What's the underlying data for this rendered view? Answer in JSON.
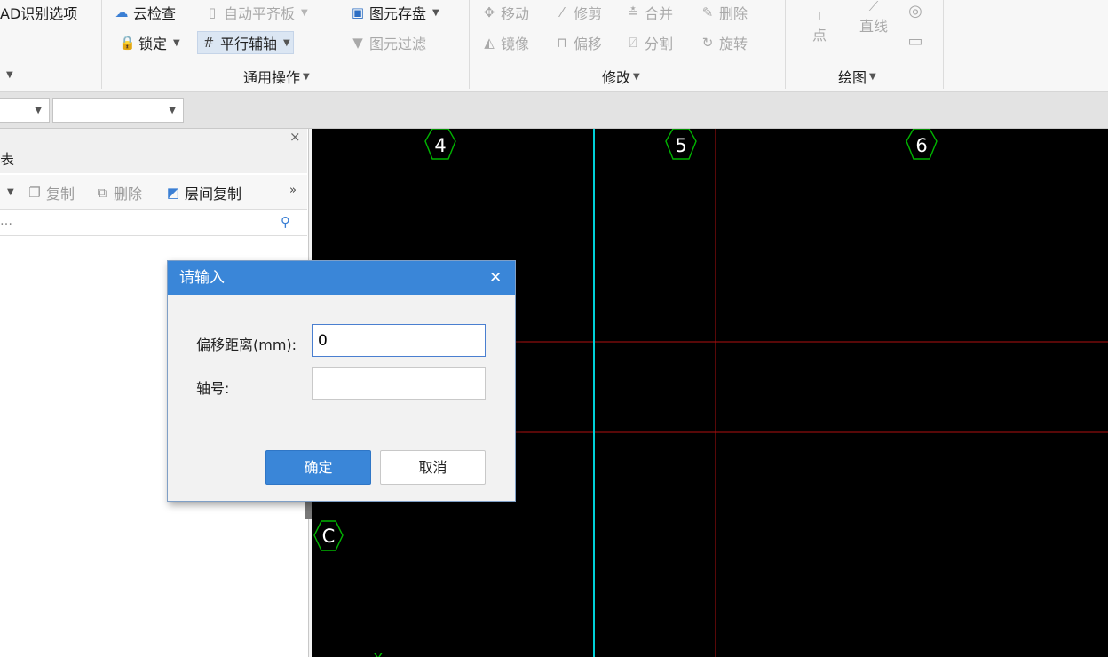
{
  "ribbon": {
    "cad_options": "AD识别选项",
    "general_ops": {
      "cloud_check": "云检查",
      "auto_align": "自动平齐板",
      "element_save": "图元存盘",
      "lock": "锁定",
      "parallel_axis": "平行辅轴",
      "element_filter": "图元过滤",
      "group_label": "通用操作"
    },
    "modify": {
      "move": "移动",
      "trim": "修剪",
      "merge": "合并",
      "delete": "删除",
      "mirror": "镜像",
      "offset": "偏移",
      "split": "分割",
      "rotate": "旋转",
      "group_label": "修改"
    },
    "draw": {
      "point": "点",
      "line": "直线",
      "group_label": "绘图"
    }
  },
  "left_panel": {
    "close_glyph": "×",
    "title_fragment": "表",
    "tools": {
      "copy": "复制",
      "delete": "删除",
      "floor_copy": "层间复制",
      "more": "»"
    },
    "search_placeholder": "…"
  },
  "canvas": {
    "axis_labels": [
      "4",
      "5",
      "6"
    ],
    "row_label": "C",
    "y_axis_marker": "Y",
    "colors": {
      "background": "#000000",
      "axis_line": "#00d0d8",
      "grid_line": "#b01010",
      "marker": "#00b400"
    }
  },
  "dialog": {
    "title": "请输入",
    "close_glyph": "✕",
    "offset_label": "偏移距离(mm):",
    "offset_value": "0",
    "axis_no_label": "轴号:",
    "axis_no_value": "",
    "ok_label": "确定",
    "cancel_label": "取消"
  }
}
